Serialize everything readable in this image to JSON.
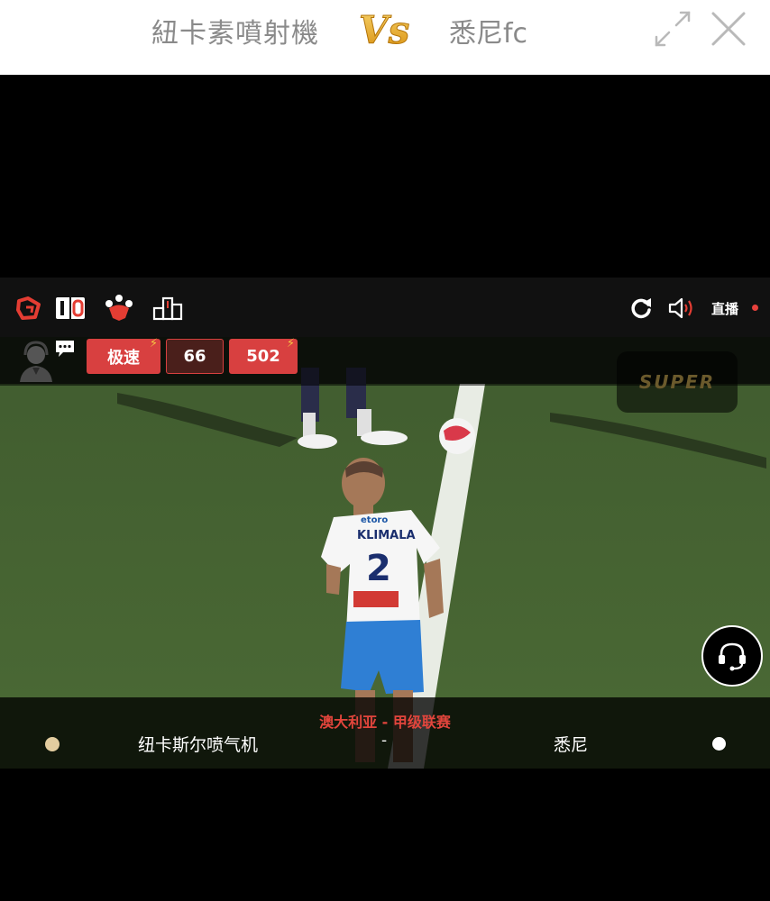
{
  "header": {
    "team_a": "紐卡素噴射機",
    "vs_label": "Vs",
    "team_b": "悉尼fc",
    "expand_icon": "expand-icon",
    "close_icon": "close-icon"
  },
  "player": {
    "topbar": {
      "logo_icon": "brand-logo-icon",
      "scoreboard_icon": "scoreboard-icon",
      "lineup_icon": "lineup-icon",
      "podium_icon": "podium-icon",
      "refresh_icon": "refresh-icon",
      "volume_icon": "volume-icon",
      "live_label": "直播",
      "live_color": "#e8413c"
    },
    "stats": {
      "speed_label": "极速",
      "count_value": "66",
      "viewers_value": "502",
      "accent_color": "#d84040"
    },
    "video": {
      "jersey_name": "KLIMALA",
      "jersey_number": "2",
      "sponsor": "etoro",
      "overlay_logo": "SUPER"
    },
    "match": {
      "league": "澳大利亚 - 甲级联赛",
      "home_team": "纽卡斯尔喷气机",
      "score": "-",
      "away_team": "悉尼",
      "home_color": "#e3cda0",
      "away_color": "#ffffff"
    }
  }
}
